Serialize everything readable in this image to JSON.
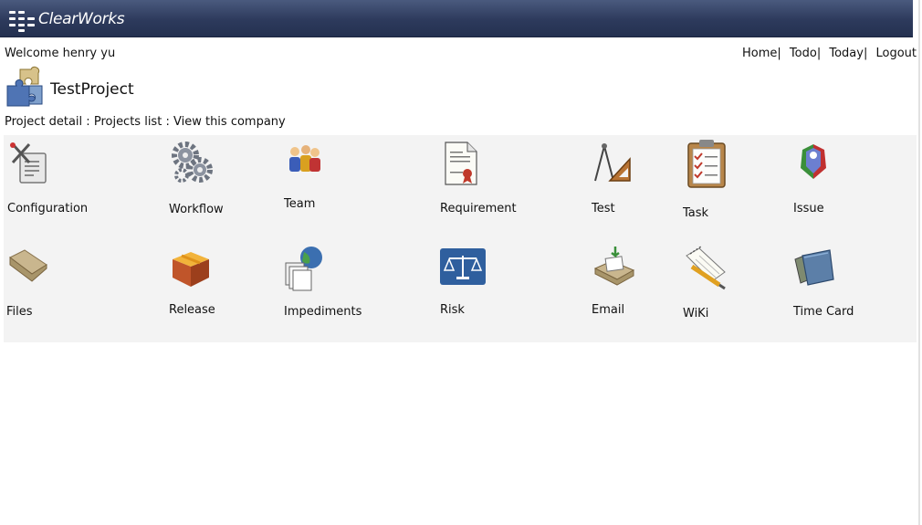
{
  "header": {
    "brand": "ClearWorks"
  },
  "welcome": "Welcome henry yu",
  "nav": {
    "home": "Home",
    "todo": "Todo",
    "today": "Today",
    "logout": "Logout",
    "separator": "|"
  },
  "project": {
    "title": "TestProject"
  },
  "breadcrumbs": {
    "detail": "Project detail",
    "list": "Projects list",
    "company": "View this company",
    "separator": ":"
  },
  "modules": [
    {
      "label": "Configuration",
      "icon": "configuration-icon"
    },
    {
      "label": "Workflow",
      "icon": "gears-icon"
    },
    {
      "label": "Team",
      "icon": "team-icon"
    },
    {
      "label": "Requirement",
      "icon": "certificate-icon"
    },
    {
      "label": "Test",
      "icon": "drafting-tools-icon"
    },
    {
      "label": "Task",
      "icon": "clipboard-checklist-icon"
    },
    {
      "label": "Issue",
      "icon": "issue-icon"
    },
    {
      "label": "Files",
      "icon": "folder-icon"
    },
    {
      "label": "Release",
      "icon": "package-icon"
    },
    {
      "label": "Impediments",
      "icon": "globe-documents-icon"
    },
    {
      "label": "Risk",
      "icon": "scales-icon"
    },
    {
      "label": "Email",
      "icon": "inbox-tray-icon"
    },
    {
      "label": "WiKi",
      "icon": "notepad-pencil-icon"
    },
    {
      "label": "Time Card",
      "icon": "time-card-icon"
    }
  ]
}
